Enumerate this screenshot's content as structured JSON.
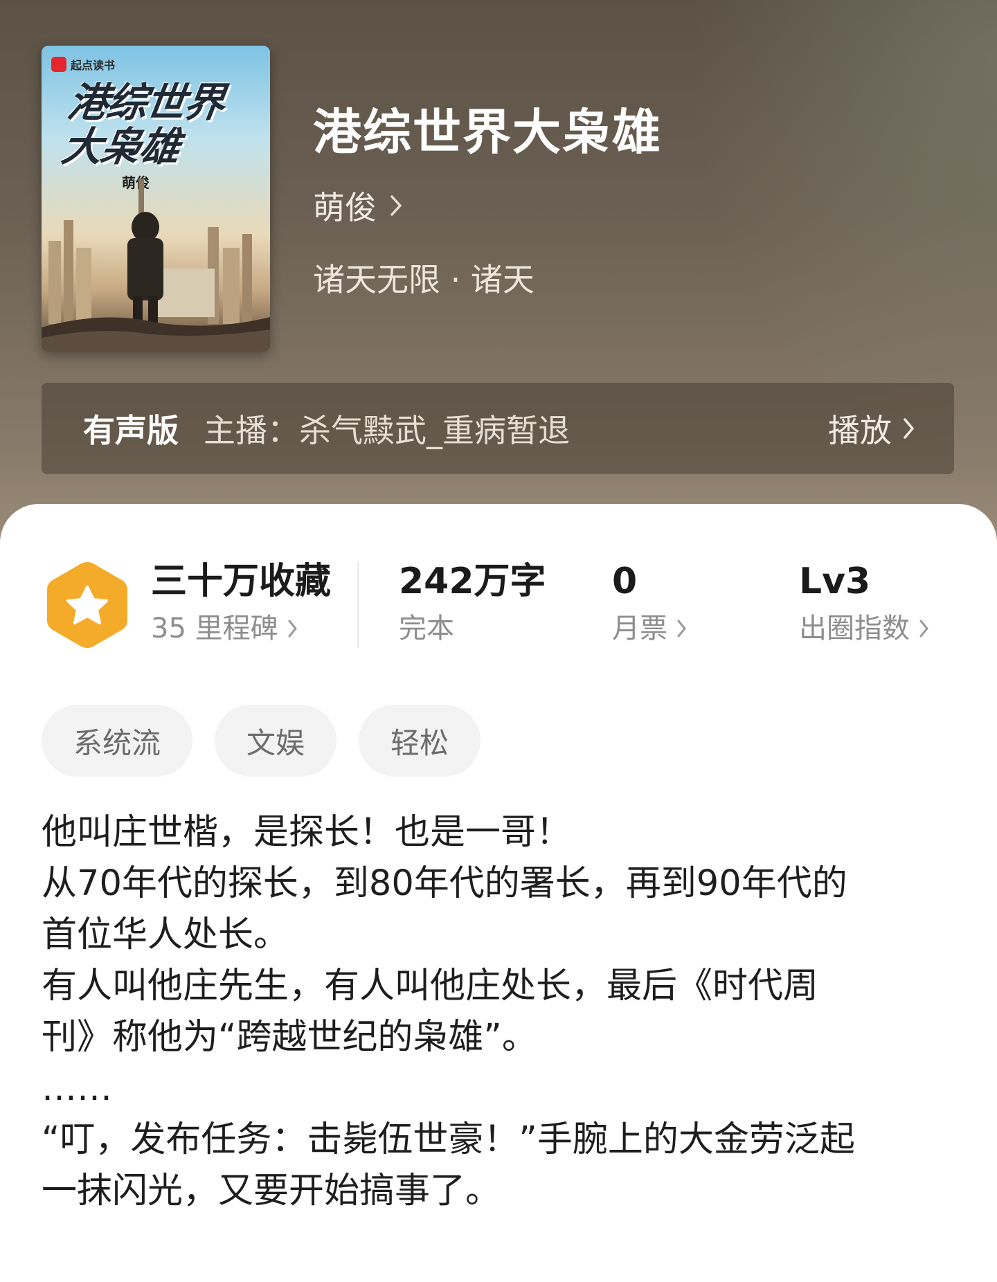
{
  "cover": {
    "brand": "起点读书",
    "title_line1": "港综世界",
    "title_line2": "大枭雄",
    "author": "萌俊"
  },
  "header": {
    "title": "港综世界大枭雄",
    "author": "萌俊",
    "category": "诸天无限 · 诸天"
  },
  "audio": {
    "badge": "有声版",
    "host": "主播：杀气黩武_重病暂退",
    "play": "播放"
  },
  "stats": {
    "collect_main": "三十万收藏",
    "collect_sub": "35 里程碑",
    "words_main": "242万字",
    "words_sub": "完本",
    "tickets_main": "0",
    "tickets_sub": "月票",
    "index_main": "Lv3",
    "index_sub": "出圈指数"
  },
  "tags": [
    "系统流",
    "文娱",
    "轻松"
  ],
  "intro": [
    "他叫庄世楷，是探长！也是一哥！",
    "从70年代的探长，到80年代的署长，再到90年代的",
    "首位华人处长。",
    "有人叫他庄先生，有人叫他庄处长，最后《时代周",
    "刊》称他为“跨越世纪的枭雄”。",
    "……",
    "“叮，发布任务：击毙伍世豪！”手腕上的大金劳泛起",
    "一抹闪光，又要开始搞事了。"
  ],
  "colors": {
    "badge_orange": "#f5ab2a",
    "hero_brown": "#6b6053"
  }
}
